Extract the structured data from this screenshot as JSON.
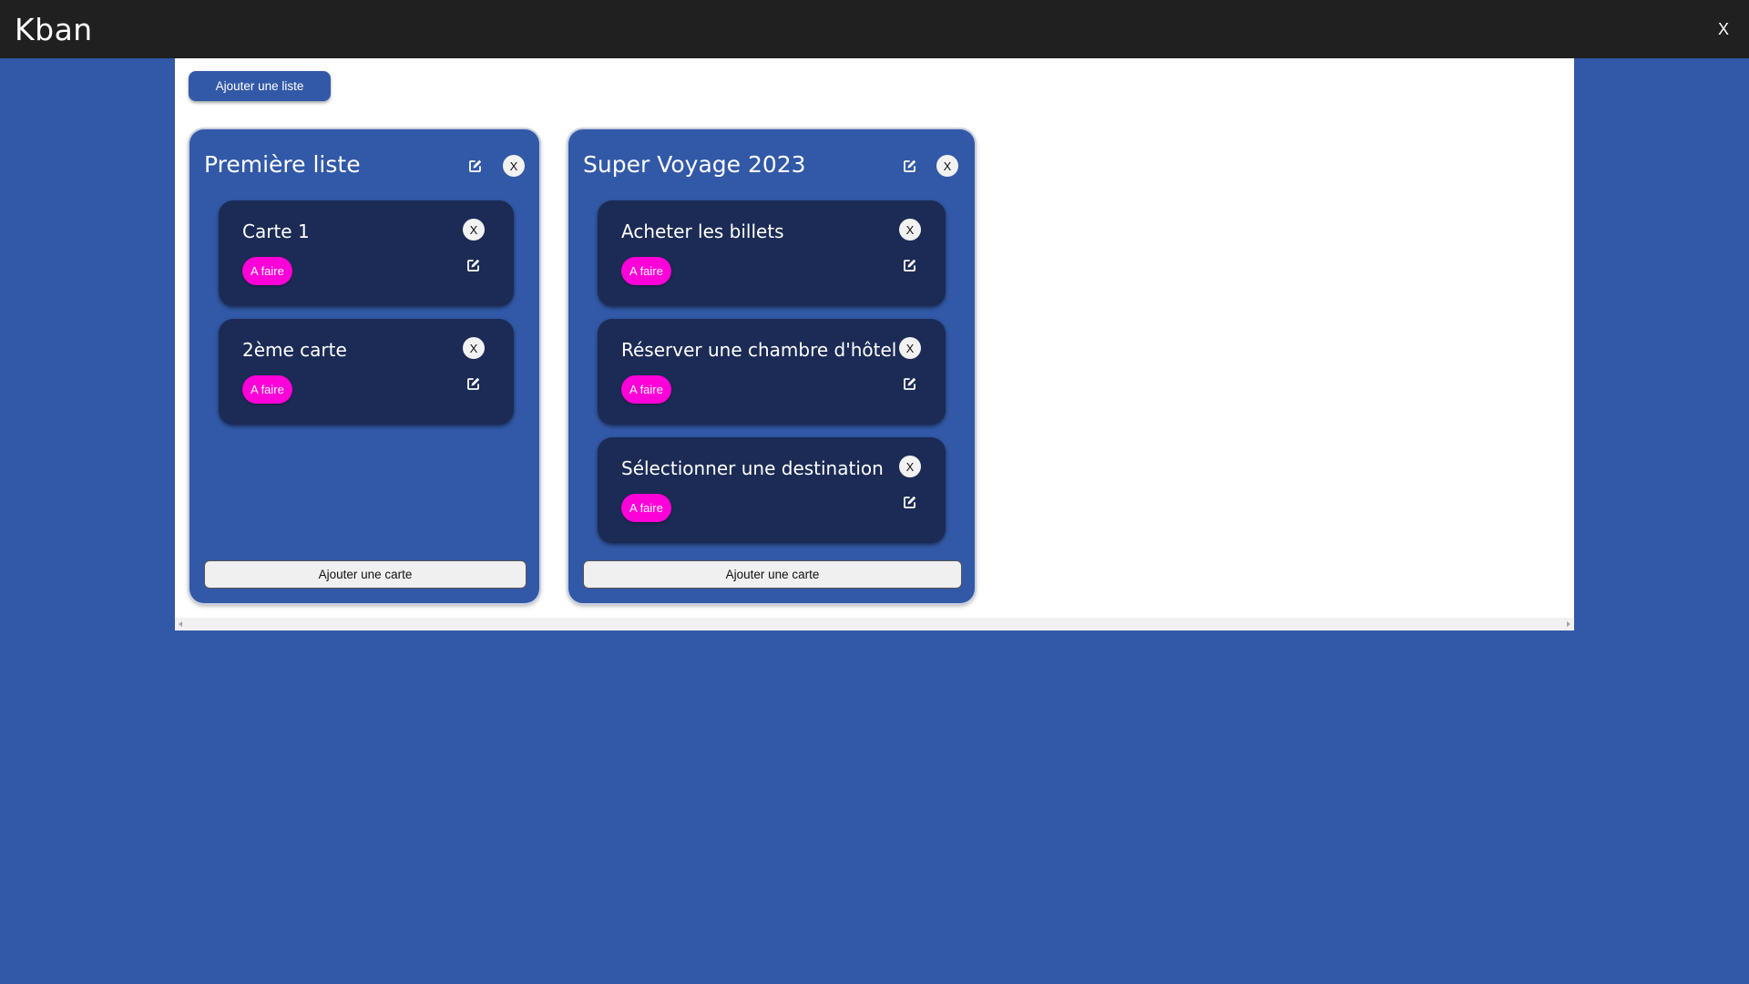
{
  "app": {
    "title": "Kban",
    "close_label": "X"
  },
  "board": {
    "add_list_label": "Ajouter une liste",
    "lists": [
      {
        "title": "Première liste",
        "close_label": "X",
        "add_card_label": "Ajouter une carte",
        "cards": [
          {
            "title": "Carte 1",
            "status": "A faire",
            "close_label": "X"
          },
          {
            "title": "2ème carte",
            "status": "A faire",
            "close_label": "X"
          }
        ]
      },
      {
        "title": "Super Voyage 2023",
        "close_label": "X",
        "add_card_label": "Ajouter une carte",
        "cards": [
          {
            "title": "Acheter les billets",
            "status": "A faire",
            "close_label": "X"
          },
          {
            "title": "Réserver une chambre d'hôtel",
            "status": "A faire",
            "close_label": "X"
          },
          {
            "title": "Sélectionner une destination",
            "status": "A faire",
            "close_label": "X"
          }
        ]
      }
    ]
  },
  "colors": {
    "background": "#3259a7",
    "topbar": "#202020",
    "card": "#1b2b55",
    "badge": "#ff00d8"
  },
  "icons": {
    "edit": "edit-icon",
    "close": "close-icon"
  }
}
